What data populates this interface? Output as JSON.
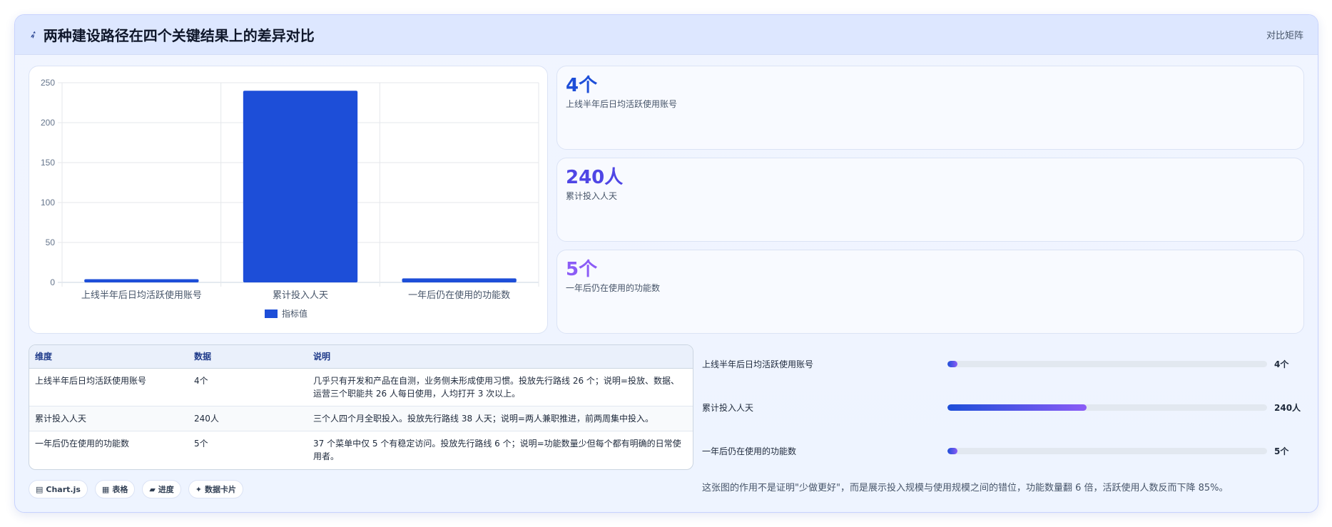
{
  "header": {
    "icon": "leaf-icon",
    "title": "两种建设路径在四个关键结果上的差异对比",
    "tag": "对比矩阵"
  },
  "chart_data": {
    "type": "bar",
    "categories": [
      "上线半年后日均活跃使用账号",
      "累计投入人天",
      "一年后仍在使用的功能数"
    ],
    "series": [
      {
        "name": "指标值",
        "values": [
          4,
          240,
          5
        ]
      }
    ],
    "ylim": [
      0,
      250
    ],
    "yticks": [
      0,
      50,
      100,
      150,
      200,
      250
    ],
    "grid": true,
    "legend_position": "bottom",
    "color": "#1d4ed8"
  },
  "stats": [
    {
      "value": "4个",
      "label": "上线半年后日均活跃使用账号",
      "color": "#1d4ed8"
    },
    {
      "value": "240人",
      "label": "累计投入人天",
      "color": "#4f46e5"
    },
    {
      "value": "5个",
      "label": "一年后仍在使用的功能数",
      "color": "#8b5cf6"
    }
  ],
  "table": {
    "headers": [
      "维度",
      "数据",
      "说明"
    ],
    "rows": [
      {
        "dim": "上线半年后日均活跃使用账号",
        "data": "4个",
        "desc": "几乎只有开发和产品在自测，业务侧未形成使用习惯。投放先行路线 26 个；说明=投放、数据、运营三个职能共 26 人每日使用，人均打开 3 次以上。"
      },
      {
        "dim": "累计投入人天",
        "data": "240人",
        "desc": "三个人四个月全职投入。投放先行路线 38 人天；说明=两人兼职推进，前两周集中投入。"
      },
      {
        "dim": "一年后仍在使用的功能数",
        "data": "5个",
        "desc": "37 个菜单中仅 5 个有稳定访问。投放先行路线 6 个；说明=功能数量少但每个都有明确的日常使用者。"
      }
    ]
  },
  "chips": [
    {
      "icon": "▤",
      "label": "Chart.js"
    },
    {
      "icon": "▦",
      "label": "表格"
    },
    {
      "icon": "▰",
      "label": "进度"
    },
    {
      "icon": "✦",
      "label": "数据卡片"
    }
  ],
  "progress": [
    {
      "label": "上线半年后日均活跃使用账号",
      "value": "4个",
      "fraction": 0.0167
    },
    {
      "label": "累计投入人天",
      "value": "240人",
      "fraction": 0.4348
    },
    {
      "label": "一年后仍在使用的功能数",
      "value": "5个",
      "fraction": 0.0208
    }
  ],
  "note": "这张图的作用不是证明\"少做更好\"，而是展示投入规模与使用规模之间的错位，功能数量翻 6 倍，活跃使用人数反而下降 85%。"
}
